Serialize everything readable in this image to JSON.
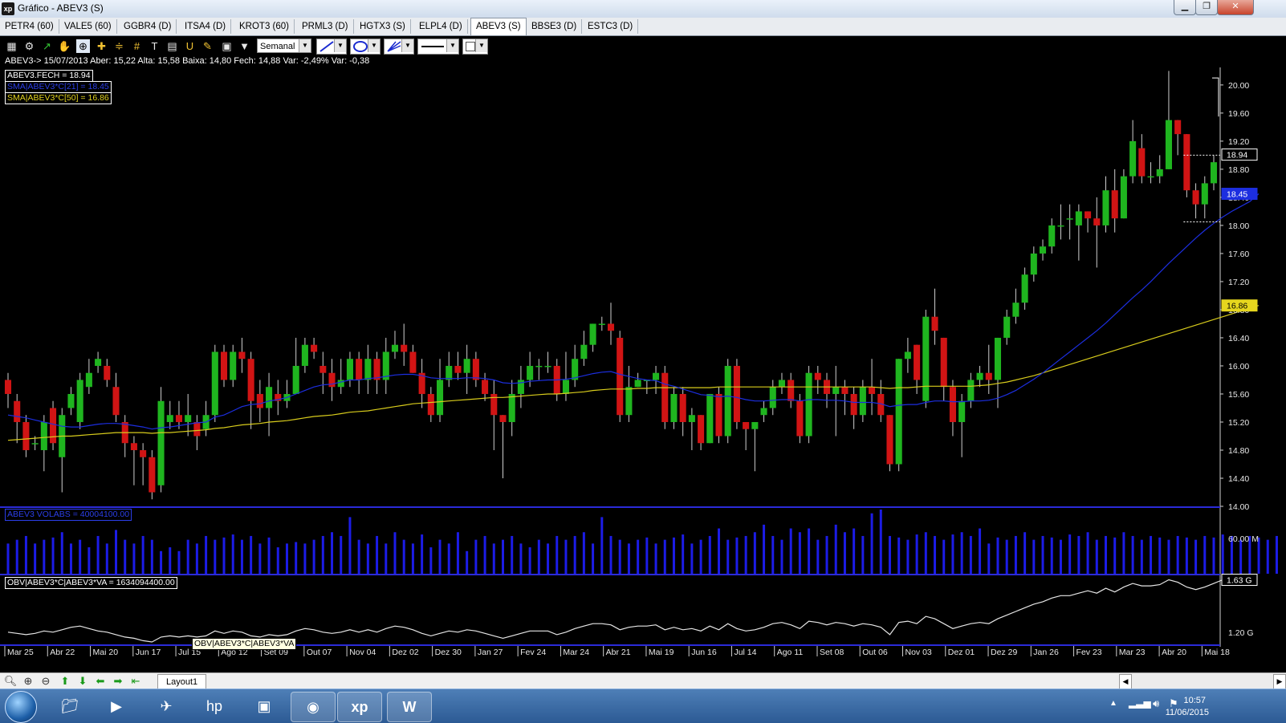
{
  "window": {
    "title": "Gráfico - ABEV3 (S)",
    "logo": "xp",
    "min": "▁",
    "max": "❐",
    "close": "✕"
  },
  "tabs": [
    {
      "label": "PETR4 (60)"
    },
    {
      "label": "VALE5 (60)"
    },
    {
      "label": "GGBR4 (D)"
    },
    {
      "label": "ITSA4 (D)"
    },
    {
      "label": "KROT3 (60)"
    },
    {
      "label": "PRML3 (D)"
    },
    {
      "label": "HGTX3 (S)"
    },
    {
      "label": "ELPL4 (D)"
    },
    {
      "label": "ABEV3 (S)",
      "active": true
    },
    {
      "label": "BBSE3 (D)"
    },
    {
      "label": "ESTC3 (D)"
    }
  ],
  "toolbar": {
    "period_select": "Semanal"
  },
  "quote_line": "ABEV3-> 15/07/2013 Aber: 15,22 Alta: 15,58 Baixa: 14,80 Fech: 14,88 Var: -2,49% Var: -0,38",
  "legends": {
    "close": "ABEV3.FECH = 18.94",
    "sma21": "SMA|ABEV3*C[21] = 18.45",
    "sma50": "SMA|ABEV3*C[50] = 16.86",
    "volume": "ABEV3 VOLABS = 40004100.00",
    "obv": "OBV|ABEV3*C|ABEV3*VA = 1634094400.00",
    "tooltip": "OBV|ABEV3*C|ABEV3*VA"
  },
  "price_markers": {
    "last": "18.94",
    "sma21": "18.45",
    "sma50": "16.86"
  },
  "volume_axis": [
    "60.00 M"
  ],
  "obv_axis": [
    "1.63 G",
    "1.20 G"
  ],
  "bottom": {
    "layout_tab": "Layout1"
  },
  "colors": {
    "up": "#1fb51f",
    "down": "#d11414",
    "sma21": "#1c2ee0",
    "sma50": "#d8cc1c",
    "volume": "#1c1ce6",
    "obv": "#e6e6e6",
    "divider": "#2b2bd8",
    "chart_bg": "#000000"
  },
  "taskbar": {
    "time": "10:57",
    "date": "11/06/2015",
    "apps": [
      "start-orb",
      "explorer",
      "media-player",
      "network",
      "hp",
      "archive",
      "chrome",
      "xp",
      "word"
    ]
  },
  "chart_data": {
    "type": "candlestick",
    "symbol": "ABEV3",
    "interval": "Semanal",
    "price_axis": {
      "ylim": [
        14.0,
        20.25
      ],
      "ticks": [
        20.0,
        19.6,
        19.2,
        18.8,
        18.4,
        18.0,
        17.6,
        17.2,
        16.8,
        16.4,
        16.0,
        15.6,
        15.2,
        14.8,
        14.4,
        14.0
      ]
    },
    "x_labels": [
      "Mar 25",
      "Abr 22",
      "Mai 20",
      "Jun 17",
      "Jul 15",
      "Ago 12",
      "Set 09",
      "Out 07",
      "Nov 04",
      "Dez 02",
      "Dez 30",
      "Jan 27",
      "Fev 24",
      "Mar 24",
      "Abr 21",
      "Mai 19",
      "Jun 16",
      "Jul 14",
      "Ago 11",
      "Set 08",
      "Out 06",
      "Nov 03",
      "Dez 01",
      "Dez 29",
      "Jan 26",
      "Fev 23",
      "Mar 23",
      "Abr 20",
      "Mai 18"
    ],
    "candles": [
      [
        15.8,
        15.6,
        15.9,
        15.4
      ],
      [
        15.5,
        15.2,
        15.6,
        14.9
      ],
      [
        15.2,
        14.8,
        15.3,
        14.7
      ],
      [
        14.9,
        14.9,
        15.0,
        14.8
      ],
      [
        14.8,
        15.2,
        15.3,
        14.5
      ],
      [
        15.4,
        14.9,
        15.5,
        14.8
      ],
      [
        14.7,
        15.3,
        15.4,
        14.2
      ],
      [
        15.4,
        15.6,
        15.7,
        15.3
      ],
      [
        15.2,
        15.8,
        15.9,
        15.1
      ],
      [
        15.7,
        15.9,
        16.1,
        15.6
      ],
      [
        16.0,
        16.1,
        16.2,
        15.9
      ],
      [
        16.0,
        15.8,
        16.1,
        15.7
      ],
      [
        15.7,
        15.3,
        15.9,
        15.2
      ],
      [
        15.2,
        14.9,
        15.3,
        14.7
      ],
      [
        14.9,
        14.8,
        15.0,
        14.3
      ],
      [
        14.8,
        14.7,
        14.9,
        14.3
      ],
      [
        14.7,
        14.2,
        14.8,
        14.1
      ],
      [
        14.3,
        15.5,
        15.7,
        14.2
      ],
      [
        15.2,
        15.3,
        15.5,
        15.1
      ],
      [
        15.3,
        15.2,
        15.5,
        15.1
      ],
      [
        15.2,
        15.3,
        15.6,
        15.0
      ],
      [
        15.2,
        15.0,
        15.3,
        14.8
      ],
      [
        15.1,
        15.3,
        15.5,
        15.0
      ],
      [
        15.3,
        16.2,
        16.3,
        15.2
      ],
      [
        16.2,
        15.8,
        16.3,
        15.7
      ],
      [
        15.8,
        16.2,
        16.3,
        15.7
      ],
      [
        16.2,
        16.1,
        16.4,
        15.9
      ],
      [
        16.1,
        15.5,
        16.2,
        15.1
      ],
      [
        15.6,
        15.4,
        15.8,
        15.2
      ],
      [
        15.4,
        15.7,
        15.9,
        15.0
      ],
      [
        15.6,
        15.5,
        15.8,
        15.3
      ],
      [
        15.5,
        15.6,
        15.8,
        15.4
      ],
      [
        15.6,
        16.0,
        16.4,
        15.6
      ],
      [
        16.0,
        16.3,
        16.4,
        15.9
      ],
      [
        16.3,
        16.2,
        16.4,
        16.1
      ],
      [
        16.0,
        15.9,
        16.2,
        15.6
      ],
      [
        15.9,
        15.7,
        16.1,
        15.5
      ],
      [
        15.7,
        15.8,
        16.1,
        15.6
      ],
      [
        15.8,
        16.1,
        16.2,
        15.7
      ],
      [
        16.1,
        15.8,
        16.2,
        15.6
      ],
      [
        15.8,
        16.1,
        16.3,
        15.6
      ],
      [
        16.1,
        15.8,
        16.2,
        15.6
      ],
      [
        15.8,
        16.2,
        16.4,
        15.6
      ],
      [
        16.2,
        16.3,
        16.5,
        16.1
      ],
      [
        16.3,
        16.2,
        16.6,
        16.0
      ],
      [
        16.2,
        15.9,
        16.3,
        15.9
      ],
      [
        15.9,
        15.6,
        16.1,
        15.4
      ],
      [
        15.6,
        15.3,
        15.7,
        15.2
      ],
      [
        15.3,
        15.8,
        16.1,
        15.2
      ],
      [
        15.8,
        16.0,
        16.2,
        15.7
      ],
      [
        16.0,
        15.9,
        16.2,
        15.8
      ],
      [
        15.9,
        16.1,
        16.3,
        15.6
      ],
      [
        16.1,
        15.8,
        16.2,
        15.7
      ],
      [
        15.8,
        15.6,
        15.9,
        15.5
      ],
      [
        15.6,
        15.3,
        15.8,
        14.8
      ],
      [
        15.3,
        15.2,
        15.3,
        14.4
      ],
      [
        15.2,
        15.6,
        15.8,
        15.0
      ],
      [
        15.6,
        15.8,
        16.0,
        15.4
      ],
      [
        15.8,
        16.0,
        16.2,
        15.7
      ],
      [
        16.0,
        16.0,
        16.1,
        15.8
      ],
      [
        16.0,
        16.0,
        16.2,
        15.9
      ],
      [
        16.0,
        15.6,
        16.1,
        15.5
      ],
      [
        15.6,
        15.8,
        16.2,
        15.5
      ],
      [
        15.8,
        16.1,
        16.3,
        15.7
      ],
      [
        16.1,
        16.3,
        16.5,
        16.0
      ],
      [
        16.3,
        16.6,
        16.6,
        16.2
      ],
      [
        16.6,
        16.6,
        16.7,
        16.5
      ],
      [
        16.6,
        16.5,
        16.9,
        16.3
      ],
      [
        16.4,
        15.3,
        16.5,
        15.2
      ],
      [
        15.3,
        15.7,
        16.0,
        15.2
      ],
      [
        15.7,
        15.8,
        15.9,
        15.7
      ],
      [
        15.8,
        15.8,
        15.8,
        15.6
      ],
      [
        15.8,
        15.9,
        16.0,
        15.6
      ],
      [
        15.9,
        15.2,
        16.0,
        15.1
      ],
      [
        15.2,
        15.6,
        15.7,
        15.1
      ],
      [
        15.6,
        15.2,
        15.7,
        15.0
      ],
      [
        15.2,
        15.3,
        15.4,
        14.8
      ],
      [
        15.3,
        14.9,
        15.3,
        14.8
      ],
      [
        14.9,
        15.6,
        15.6,
        14.9
      ],
      [
        15.6,
        15.0,
        15.7,
        14.9
      ],
      [
        15.0,
        16.0,
        16.1,
        14.9
      ],
      [
        16.0,
        15.2,
        16.1,
        15.1
      ],
      [
        15.2,
        15.1,
        15.2,
        14.8
      ],
      [
        15.1,
        15.2,
        15.2,
        14.5
      ],
      [
        15.3,
        15.4,
        15.5,
        15.2
      ],
      [
        15.4,
        15.7,
        15.8,
        15.3
      ],
      [
        15.7,
        15.8,
        15.9,
        15.6
      ],
      [
        15.8,
        15.5,
        15.9,
        15.4
      ],
      [
        15.5,
        15.0,
        15.6,
        14.9
      ],
      [
        15.0,
        15.9,
        16.0,
        14.9
      ],
      [
        15.9,
        15.8,
        16.0,
        15.6
      ],
      [
        15.8,
        15.6,
        15.9,
        15.4
      ],
      [
        15.6,
        15.7,
        16.0,
        15.0
      ],
      [
        15.7,
        15.6,
        15.8,
        15.3
      ],
      [
        15.6,
        15.3,
        15.7,
        15.1
      ],
      [
        15.3,
        15.7,
        15.8,
        15.2
      ],
      [
        15.7,
        15.6,
        16.1,
        15.3
      ],
      [
        15.6,
        15.3,
        15.8,
        15.2
      ],
      [
        15.3,
        14.6,
        15.3,
        14.5
      ],
      [
        14.6,
        16.1,
        16.1,
        14.5
      ],
      [
        16.1,
        16.2,
        16.4,
        15.9
      ],
      [
        16.3,
        15.8,
        16.3,
        15.6
      ],
      [
        15.5,
        16.7,
        16.8,
        15.4
      ],
      [
        16.7,
        16.5,
        17.1,
        16.3
      ],
      [
        16.4,
        15.7,
        16.4,
        15.5
      ],
      [
        15.7,
        15.2,
        15.8,
        15.0
      ],
      [
        15.2,
        15.5,
        15.6,
        14.7
      ],
      [
        15.5,
        15.8,
        15.9,
        15.4
      ],
      [
        15.8,
        15.9,
        16.0,
        15.7
      ],
      [
        15.9,
        15.8,
        16.3,
        15.6
      ],
      [
        15.8,
        16.4,
        16.4,
        15.4
      ],
      [
        16.4,
        16.7,
        16.8,
        16.3
      ],
      [
        16.7,
        16.9,
        17.1,
        16.6
      ],
      [
        16.9,
        17.3,
        17.4,
        16.8
      ],
      [
        17.3,
        17.6,
        17.7,
        17.2
      ],
      [
        17.6,
        17.7,
        17.8,
        17.5
      ],
      [
        17.7,
        18.0,
        18.1,
        17.6
      ],
      [
        18.0,
        18.0,
        18.3,
        17.8
      ],
      [
        18.1,
        18.1,
        18.3,
        17.8
      ],
      [
        18.0,
        18.2,
        18.3,
        17.5
      ],
      [
        18.2,
        18.1,
        18.2,
        17.9
      ],
      [
        18.1,
        18.0,
        18.4,
        17.4
      ],
      [
        18.0,
        18.5,
        18.7,
        17.9
      ],
      [
        18.5,
        18.1,
        18.8,
        17.9
      ],
      [
        18.1,
        18.7,
        18.8,
        18.1
      ],
      [
        18.7,
        19.2,
        19.5,
        18.6
      ],
      [
        19.1,
        18.7,
        19.3,
        18.6
      ],
      [
        18.7,
        18.7,
        18.9,
        18.6
      ],
      [
        18.7,
        18.8,
        19.0,
        18.6
      ],
      [
        18.8,
        19.5,
        20.2,
        18.8
      ],
      [
        19.5,
        19.3,
        19.5,
        19.0
      ],
      [
        19.3,
        18.5,
        19.3,
        18.4
      ],
      [
        18.5,
        18.3,
        18.6,
        18.1
      ],
      [
        18.3,
        18.6,
        18.7,
        18.1
      ],
      [
        18.6,
        18.9,
        19.0,
        18.5
      ]
    ],
    "sma21": [
      15.3,
      15.28,
      15.26,
      15.23,
      15.2,
      15.17,
      15.14,
      15.13,
      15.13,
      15.15,
      15.17,
      15.18,
      15.18,
      15.17,
      15.15,
      15.13,
      15.1,
      15.12,
      15.13,
      15.15,
      15.17,
      15.19,
      15.2,
      15.27,
      15.3,
      15.36,
      15.42,
      15.45,
      15.46,
      15.5,
      15.52,
      15.55,
      15.6,
      15.65,
      15.7,
      15.73,
      15.74,
      15.77,
      15.8,
      15.8,
      15.82,
      15.83,
      15.85,
      15.87,
      15.88,
      15.88,
      15.86,
      15.83,
      15.82,
      15.82,
      15.82,
      15.83,
      15.83,
      15.82,
      15.8,
      15.76,
      15.75,
      15.76,
      15.78,
      15.79,
      15.8,
      15.8,
      15.81,
      15.83,
      15.86,
      15.89,
      15.91,
      15.92,
      15.88,
      15.85,
      15.82,
      15.8,
      15.79,
      15.74,
      15.71,
      15.67,
      15.63,
      15.59,
      15.58,
      15.56,
      15.57,
      15.55,
      15.52,
      15.5,
      15.5,
      15.51,
      15.52,
      15.52,
      15.5,
      15.52,
      15.52,
      15.51,
      15.51,
      15.5,
      15.48,
      15.48,
      15.48,
      15.46,
      15.42,
      15.44,
      15.45,
      15.45,
      15.48,
      15.5,
      15.5,
      15.49,
      15.49,
      15.5,
      15.5,
      15.51,
      15.54,
      15.59,
      15.65,
      15.73,
      15.81,
      15.9,
      16.0,
      16.1,
      16.2,
      16.3,
      16.4,
      16.5,
      16.61,
      16.73,
      16.85,
      16.97,
      17.08,
      17.2,
      17.33,
      17.46,
      17.58,
      17.7,
      17.82,
      17.93,
      18.03,
      18.12,
      18.2,
      18.27,
      18.34,
      18.45
    ],
    "sma50": [
      14.94,
      14.95,
      14.96,
      14.97,
      14.98,
      14.99,
      15.0,
      15.0,
      15.01,
      15.02,
      15.03,
      15.04,
      15.05,
      15.05,
      15.05,
      15.05,
      15.04,
      15.05,
      15.05,
      15.06,
      15.07,
      15.08,
      15.09,
      15.11,
      15.12,
      15.14,
      15.16,
      15.17,
      15.18,
      15.2,
      15.21,
      15.22,
      15.24,
      15.26,
      15.28,
      15.29,
      15.3,
      15.32,
      15.34,
      15.35,
      15.36,
      15.38,
      15.4,
      15.42,
      15.44,
      15.46,
      15.47,
      15.48,
      15.49,
      15.5,
      15.51,
      15.52,
      15.53,
      15.54,
      15.55,
      15.55,
      15.56,
      15.57,
      15.58,
      15.59,
      15.6,
      15.6,
      15.61,
      15.62,
      15.63,
      15.65,
      15.66,
      15.67,
      15.67,
      15.67,
      15.68,
      15.68,
      15.69,
      15.69,
      15.69,
      15.69,
      15.69,
      15.69,
      15.69,
      15.7,
      15.7,
      15.7,
      15.7,
      15.7,
      15.7,
      15.7,
      15.7,
      15.7,
      15.7,
      15.7,
      15.7,
      15.7,
      15.7,
      15.7,
      15.7,
      15.7,
      15.7,
      15.69,
      15.68,
      15.69,
      15.69,
      15.7,
      15.71,
      15.71,
      15.71,
      15.71,
      15.71,
      15.71,
      15.72,
      15.73,
      15.75,
      15.77,
      15.8,
      15.83,
      15.86,
      15.9,
      15.94,
      15.98,
      16.02,
      16.06,
      16.1,
      16.14,
      16.18,
      16.22,
      16.26,
      16.3,
      16.34,
      16.38,
      16.42,
      16.46,
      16.5,
      16.54,
      16.58,
      16.62,
      16.66,
      16.7,
      16.74,
      16.78,
      16.82,
      16.86
    ],
    "volume_millions": [
      40,
      45,
      50,
      40,
      45,
      48,
      55,
      40,
      45,
      35,
      50,
      40,
      58,
      45,
      40,
      50,
      45,
      30,
      35,
      30,
      45,
      40,
      50,
      45,
      48,
      52,
      45,
      50,
      40,
      48,
      35,
      40,
      42,
      40,
      45,
      50,
      55,
      50,
      75,
      45,
      40,
      50,
      40,
      55,
      45,
      40,
      52,
      35,
      45,
      40,
      55,
      30,
      45,
      50,
      40,
      45,
      50,
      40,
      35,
      45,
      40,
      50,
      45,
      50,
      55,
      40,
      75,
      50,
      45,
      40,
      45,
      48,
      40,
      45,
      48,
      52,
      40,
      45,
      50,
      60,
      45,
      48,
      50,
      55,
      65,
      50,
      45,
      60,
      55,
      60,
      45,
      50,
      65,
      55,
      60,
      50,
      80,
      85,
      50,
      48,
      45,
      52,
      55,
      50,
      45,
      52,
      55,
      50,
      60,
      40,
      48,
      45,
      50,
      55,
      45,
      50,
      48,
      45,
      52,
      50,
      55,
      45,
      50,
      48,
      55,
      50,
      45,
      50,
      48,
      45,
      50,
      48,
      45,
      50,
      48,
      52,
      50,
      45,
      50,
      48,
      45,
      50
    ],
    "obv": [
      1.2,
      1.19,
      1.18,
      1.19,
      1.21,
      1.2,
      1.22,
      1.24,
      1.25,
      1.23,
      1.21,
      1.2,
      1.18,
      1.16,
      1.15,
      1.13,
      1.12,
      1.16,
      1.17,
      1.16,
      1.17,
      1.16,
      1.17,
      1.21,
      1.19,
      1.21,
      1.2,
      1.17,
      1.16,
      1.18,
      1.17,
      1.18,
      1.21,
      1.23,
      1.22,
      1.2,
      1.19,
      1.2,
      1.22,
      1.2,
      1.22,
      1.2,
      1.23,
      1.25,
      1.24,
      1.22,
      1.19,
      1.17,
      1.19,
      1.21,
      1.2,
      1.22,
      1.21,
      1.19,
      1.17,
      1.15,
      1.17,
      1.19,
      1.21,
      1.21,
      1.21,
      1.18,
      1.2,
      1.23,
      1.25,
      1.27,
      1.27,
      1.26,
      1.22,
      1.24,
      1.25,
      1.25,
      1.26,
      1.22,
      1.24,
      1.22,
      1.23,
      1.21,
      1.25,
      1.22,
      1.27,
      1.23,
      1.21,
      1.22,
      1.24,
      1.27,
      1.28,
      1.26,
      1.23,
      1.29,
      1.28,
      1.26,
      1.28,
      1.27,
      1.25,
      1.27,
      1.26,
      1.24,
      1.18,
      1.28,
      1.29,
      1.27,
      1.33,
      1.31,
      1.27,
      1.23,
      1.25,
      1.27,
      1.28,
      1.27,
      1.31,
      1.34,
      1.37,
      1.4,
      1.43,
      1.45,
      1.48,
      1.5,
      1.5,
      1.52,
      1.54,
      1.52,
      1.56,
      1.53,
      1.57,
      1.6,
      1.58,
      1.58,
      1.59,
      1.63,
      1.61,
      1.57,
      1.55,
      1.57,
      1.6,
      1.63
    ]
  }
}
